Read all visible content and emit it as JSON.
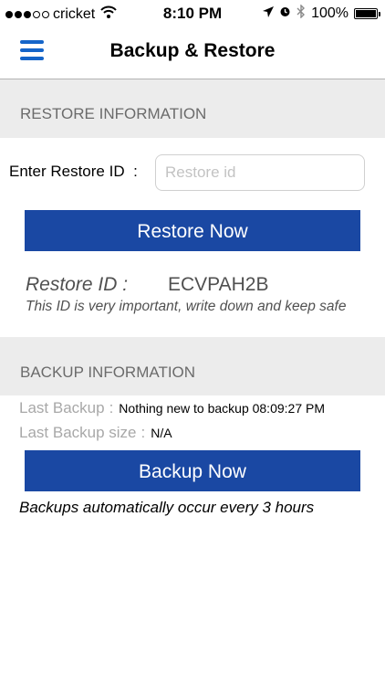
{
  "status_bar": {
    "carrier": "cricket",
    "time": "8:10 PM",
    "battery": "100%",
    "icons": [
      "signal-dots",
      "wifi-icon",
      "location-arrow-icon",
      "alarm-icon",
      "bluetooth-icon",
      "battery-icon"
    ],
    "battery_level": 1.0
  },
  "nav": {
    "title": "Backup & Restore",
    "menu_icon": "hamburger-menu-icon"
  },
  "restore": {
    "section_title": "RESTORE INFORMATION",
    "id_label": "Enter Restore ID",
    "id_separator": ":",
    "id_placeholder": "Restore id",
    "id_value": "",
    "button_label": "Restore Now",
    "current_id_label": "Restore ID :",
    "current_id_value": "ECVPAH2B",
    "note": "This ID is very important, write down and keep safe"
  },
  "backup": {
    "section_title": "BACKUP INFORMATION",
    "last_backup_label": "Last Backup",
    "last_backup_value": "Nothing new to backup 08:09:27 PM",
    "last_size_label": "Last Backup size",
    "last_size_value": "N/A",
    "separator": ":",
    "button_label": "Backup Now",
    "note": "Backups automatically occur every 3 hours"
  },
  "colors": {
    "accent": "#1a48a3",
    "menu_icon": "#1565c9",
    "section_bg": "#ececec"
  }
}
